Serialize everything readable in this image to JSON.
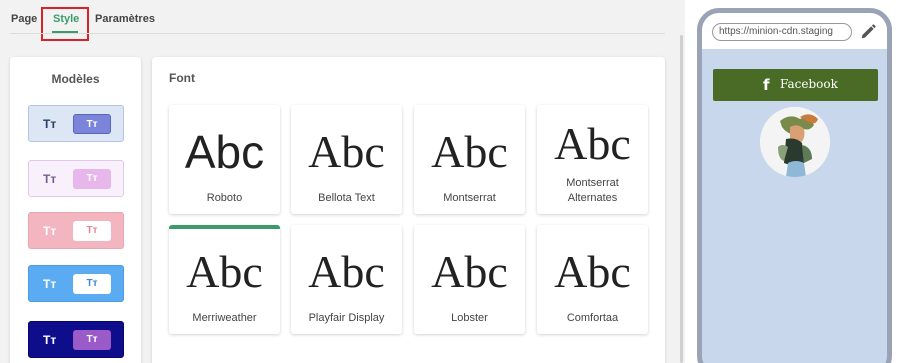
{
  "tabs": {
    "page": "Page",
    "style": "Style",
    "params": "Paramètres"
  },
  "models": {
    "title": "Modèles",
    "items": [
      {
        "left": "Tт",
        "btn": "Tт"
      },
      {
        "left": "Tт",
        "btn": "Tт"
      },
      {
        "left": "Tт",
        "btn": "Tт"
      },
      {
        "left": "Tт",
        "btn": "Tт"
      },
      {
        "left": "Tт",
        "btn": "Tт"
      }
    ]
  },
  "font": {
    "title": "Font",
    "sample": "Abc",
    "selected": "Merriweather",
    "items": [
      {
        "name": "Roboto"
      },
      {
        "name": "Bellota Text"
      },
      {
        "name": "Montserrat"
      },
      {
        "name": "Montserrat Alternates"
      },
      {
        "name": "Merriweather"
      },
      {
        "name": "Playfair Display"
      },
      {
        "name": "Lobster"
      },
      {
        "name": "Comfortaa"
      }
    ]
  },
  "preview": {
    "url": "https://minion-cdn.staging",
    "facebook_label": "Facebook",
    "facebook_icon": "facebook-icon",
    "edit_icon": "pencil-icon",
    "button_color": "#4a6b25",
    "background_color": "#c9d7ec"
  },
  "colors": {
    "accent": "#3d9a6a",
    "highlight": "#d8232a"
  }
}
